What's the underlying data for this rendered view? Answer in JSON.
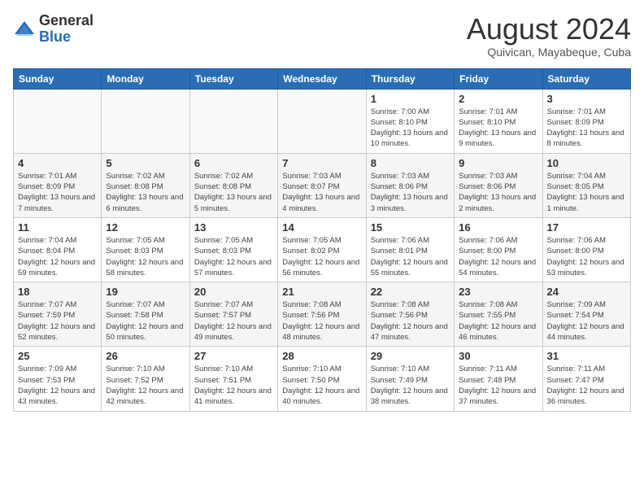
{
  "header": {
    "logo_general": "General",
    "logo_blue": "Blue",
    "month_title": "August 2024",
    "location": "Quivican, Mayabeque, Cuba"
  },
  "days_of_week": [
    "Sunday",
    "Monday",
    "Tuesday",
    "Wednesday",
    "Thursday",
    "Friday",
    "Saturday"
  ],
  "weeks": [
    [
      {
        "day": "",
        "info": ""
      },
      {
        "day": "",
        "info": ""
      },
      {
        "day": "",
        "info": ""
      },
      {
        "day": "",
        "info": ""
      },
      {
        "day": "1",
        "info": "Sunrise: 7:00 AM\nSunset: 8:10 PM\nDaylight: 13 hours and 10 minutes."
      },
      {
        "day": "2",
        "info": "Sunrise: 7:01 AM\nSunset: 8:10 PM\nDaylight: 13 hours and 9 minutes."
      },
      {
        "day": "3",
        "info": "Sunrise: 7:01 AM\nSunset: 8:09 PM\nDaylight: 13 hours and 8 minutes."
      }
    ],
    [
      {
        "day": "4",
        "info": "Sunrise: 7:01 AM\nSunset: 8:09 PM\nDaylight: 13 hours and 7 minutes."
      },
      {
        "day": "5",
        "info": "Sunrise: 7:02 AM\nSunset: 8:08 PM\nDaylight: 13 hours and 6 minutes."
      },
      {
        "day": "6",
        "info": "Sunrise: 7:02 AM\nSunset: 8:08 PM\nDaylight: 13 hours and 5 minutes."
      },
      {
        "day": "7",
        "info": "Sunrise: 7:03 AM\nSunset: 8:07 PM\nDaylight: 13 hours and 4 minutes."
      },
      {
        "day": "8",
        "info": "Sunrise: 7:03 AM\nSunset: 8:06 PM\nDaylight: 13 hours and 3 minutes."
      },
      {
        "day": "9",
        "info": "Sunrise: 7:03 AM\nSunset: 8:06 PM\nDaylight: 13 hours and 2 minutes."
      },
      {
        "day": "10",
        "info": "Sunrise: 7:04 AM\nSunset: 8:05 PM\nDaylight: 13 hours and 1 minute."
      }
    ],
    [
      {
        "day": "11",
        "info": "Sunrise: 7:04 AM\nSunset: 8:04 PM\nDaylight: 12 hours and 59 minutes."
      },
      {
        "day": "12",
        "info": "Sunrise: 7:05 AM\nSunset: 8:03 PM\nDaylight: 12 hours and 58 minutes."
      },
      {
        "day": "13",
        "info": "Sunrise: 7:05 AM\nSunset: 8:03 PM\nDaylight: 12 hours and 57 minutes."
      },
      {
        "day": "14",
        "info": "Sunrise: 7:05 AM\nSunset: 8:02 PM\nDaylight: 12 hours and 56 minutes."
      },
      {
        "day": "15",
        "info": "Sunrise: 7:06 AM\nSunset: 8:01 PM\nDaylight: 12 hours and 55 minutes."
      },
      {
        "day": "16",
        "info": "Sunrise: 7:06 AM\nSunset: 8:00 PM\nDaylight: 12 hours and 54 minutes."
      },
      {
        "day": "17",
        "info": "Sunrise: 7:06 AM\nSunset: 8:00 PM\nDaylight: 12 hours and 53 minutes."
      }
    ],
    [
      {
        "day": "18",
        "info": "Sunrise: 7:07 AM\nSunset: 7:59 PM\nDaylight: 12 hours and 52 minutes."
      },
      {
        "day": "19",
        "info": "Sunrise: 7:07 AM\nSunset: 7:58 PM\nDaylight: 12 hours and 50 minutes."
      },
      {
        "day": "20",
        "info": "Sunrise: 7:07 AM\nSunset: 7:57 PM\nDaylight: 12 hours and 49 minutes."
      },
      {
        "day": "21",
        "info": "Sunrise: 7:08 AM\nSunset: 7:56 PM\nDaylight: 12 hours and 48 minutes."
      },
      {
        "day": "22",
        "info": "Sunrise: 7:08 AM\nSunset: 7:56 PM\nDaylight: 12 hours and 47 minutes."
      },
      {
        "day": "23",
        "info": "Sunrise: 7:08 AM\nSunset: 7:55 PM\nDaylight: 12 hours and 46 minutes."
      },
      {
        "day": "24",
        "info": "Sunrise: 7:09 AM\nSunset: 7:54 PM\nDaylight: 12 hours and 44 minutes."
      }
    ],
    [
      {
        "day": "25",
        "info": "Sunrise: 7:09 AM\nSunset: 7:53 PM\nDaylight: 12 hours and 43 minutes."
      },
      {
        "day": "26",
        "info": "Sunrise: 7:10 AM\nSunset: 7:52 PM\nDaylight: 12 hours and 42 minutes."
      },
      {
        "day": "27",
        "info": "Sunrise: 7:10 AM\nSunset: 7:51 PM\nDaylight: 12 hours and 41 minutes."
      },
      {
        "day": "28",
        "info": "Sunrise: 7:10 AM\nSunset: 7:50 PM\nDaylight: 12 hours and 40 minutes."
      },
      {
        "day": "29",
        "info": "Sunrise: 7:10 AM\nSunset: 7:49 PM\nDaylight: 12 hours and 38 minutes."
      },
      {
        "day": "30",
        "info": "Sunrise: 7:11 AM\nSunset: 7:48 PM\nDaylight: 12 hours and 37 minutes."
      },
      {
        "day": "31",
        "info": "Sunrise: 7:11 AM\nSunset: 7:47 PM\nDaylight: 12 hours and 36 minutes."
      }
    ]
  ]
}
